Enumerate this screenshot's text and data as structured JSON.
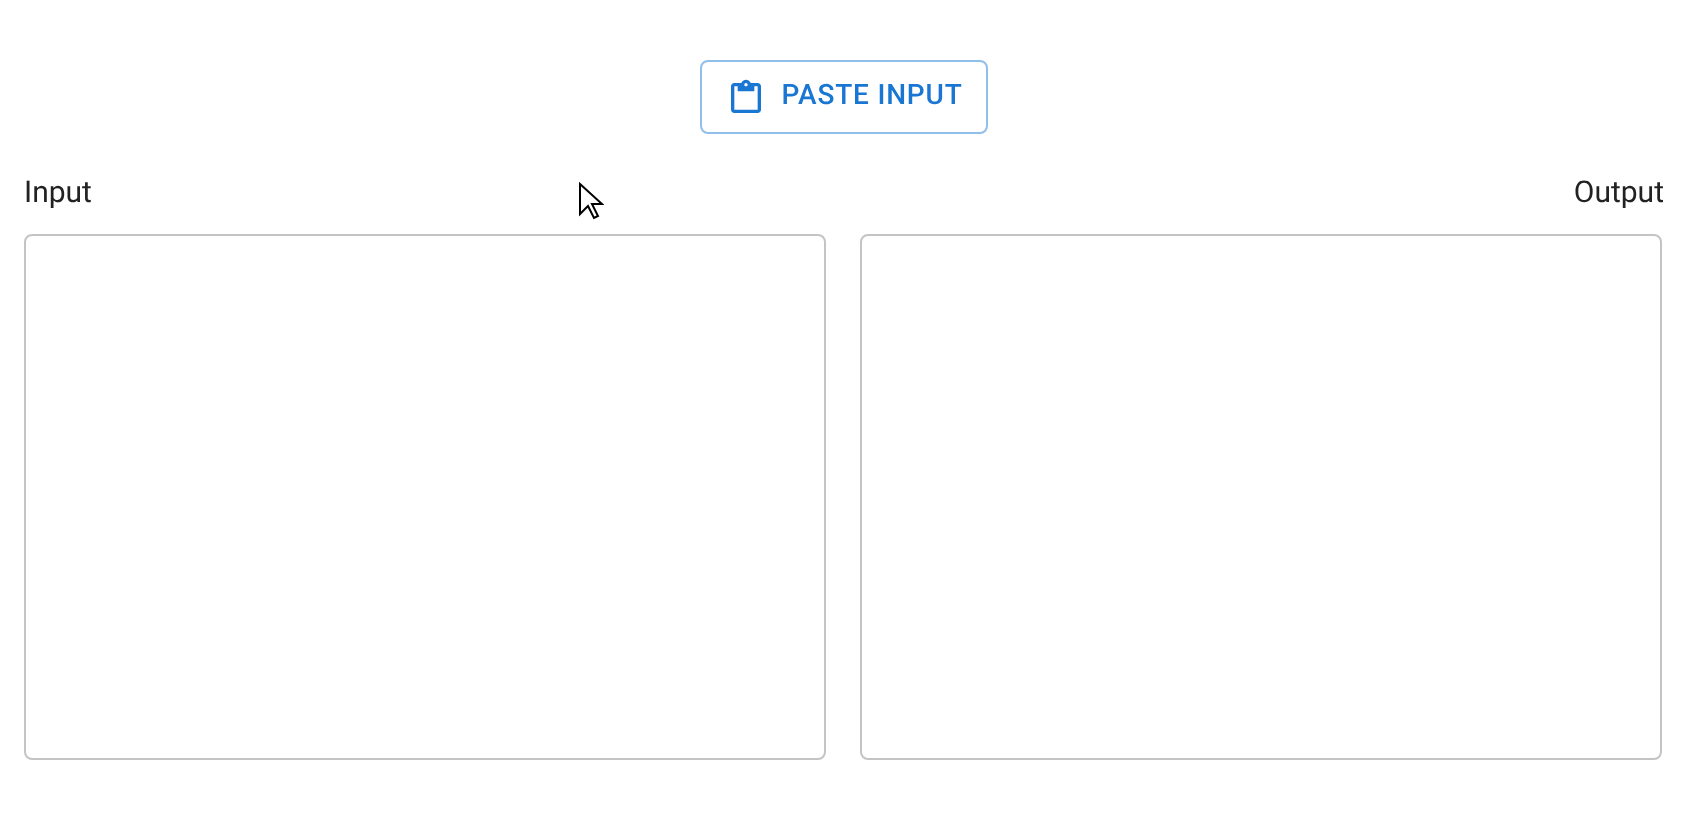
{
  "paste_button": {
    "label": "PASTE INPUT"
  },
  "input": {
    "label": "Input"
  },
  "output": {
    "label": "Output"
  }
}
